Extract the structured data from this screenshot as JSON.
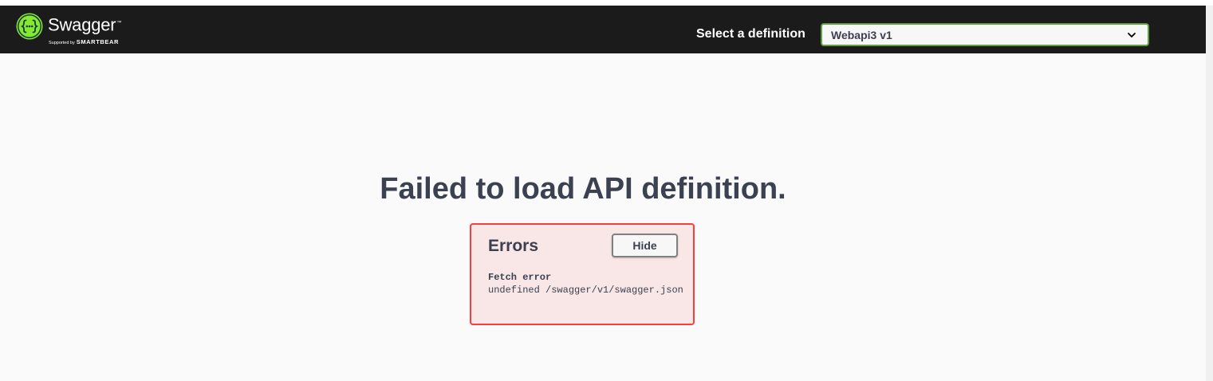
{
  "header": {
    "logo": {
      "name": "Swagger",
      "trademark": "™",
      "supported_by": "Supported by",
      "brand": "SMARTBEAR",
      "icon": "swagger-braces-icon",
      "icon_color": "#85ea2d"
    },
    "definition_label": "Select a definition",
    "definition_select": {
      "value": "Webapi3 v1",
      "border_color": "#62a03f"
    },
    "background_color": "#1b1b1b"
  },
  "main": {
    "message": "Failed to load API definition.",
    "errors": {
      "title": "Errors",
      "hide_label": "Hide",
      "items": [
        {
          "heading": "Fetch error",
          "message": "undefined /swagger/v1/swagger.json"
        }
      ],
      "border_color": "#f93e3e",
      "background_color": "#f9e6e6"
    }
  }
}
